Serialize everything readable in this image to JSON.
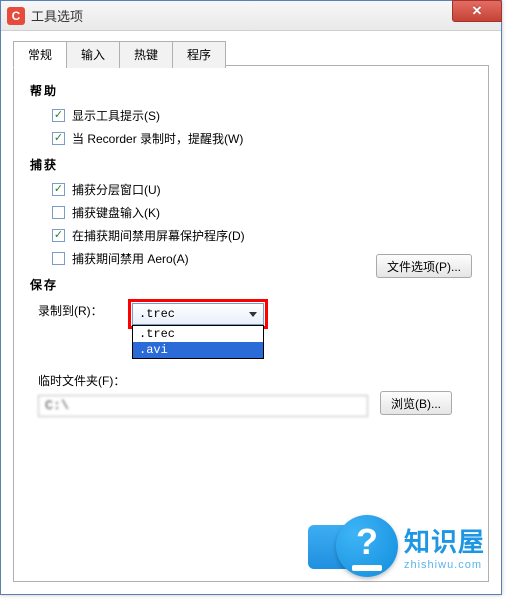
{
  "window": {
    "title": "工具选项",
    "app_icon_letter": "C"
  },
  "tabs": [
    {
      "label": "常规",
      "active": true
    },
    {
      "label": "输入",
      "active": false
    },
    {
      "label": "热键",
      "active": false
    },
    {
      "label": "程序",
      "active": false
    }
  ],
  "sections": {
    "help": {
      "title": "帮助",
      "items": [
        {
          "label": "显示工具提示(S)",
          "checked": true
        },
        {
          "label": "当 Recorder 录制时，提醒我(W)",
          "checked": true
        }
      ]
    },
    "capture": {
      "title": "捕获",
      "items": [
        {
          "label": "捕获分层窗口(U)",
          "checked": true
        },
        {
          "label": "捕获键盘输入(K)",
          "checked": false
        },
        {
          "label": "在捕获期间禁用屏幕保护程序(D)",
          "checked": true
        },
        {
          "label": "捕获期间禁用 Aero(A)",
          "checked": false
        }
      ]
    },
    "save": {
      "title": "保存",
      "record_to_label": "录制到(R)：",
      "combo": {
        "selected": ".trec",
        "options": [
          {
            "label": ".trec",
            "highlighted": false
          },
          {
            "label": ".avi",
            "highlighted": true
          }
        ]
      },
      "file_options_label": "文件选项(P)...",
      "temp_folder_label": "临时文件夹(F)：",
      "path_value": "C:\\                                  ",
      "browse_label": "浏览(B)..."
    }
  },
  "overlay": {
    "zh": "知识屋",
    "en": "zhishiwu.com",
    "q": "?"
  }
}
